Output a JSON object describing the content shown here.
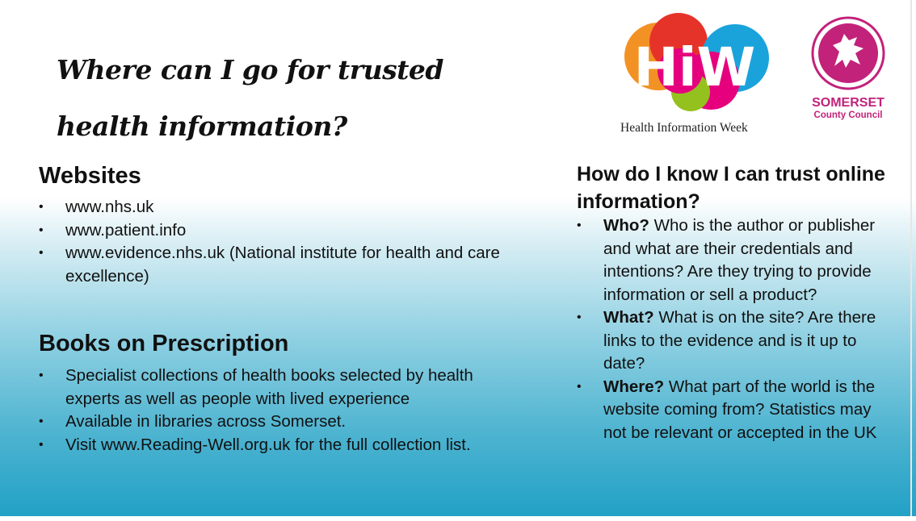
{
  "title": "Where can I go for trusted health information?",
  "logos": {
    "hiw_text": "HiW",
    "hiw_caption": "Health Information Week",
    "council_name": "SOMERSET",
    "council_sub": "County Council"
  },
  "websites": {
    "heading": "Websites",
    "items": [
      "www.nhs.uk",
      "www.patient.info",
      "www.evidence.nhs.uk (National institute for health and care excellence)"
    ]
  },
  "books": {
    "heading": "Books on Prescription",
    "items": [
      "Specialist collections of health books selected by health experts as well as people with lived experience",
      "Available in libraries across Somerset.",
      "Visit www.Reading-Well.org.uk for the full collection list."
    ]
  },
  "trust": {
    "heading": "How do I know I can trust online information?",
    "items": [
      {
        "label": "Who?",
        "text": "Who is the author or publisher and what are their credentials and intentions? Are they trying to provide information or sell a product?"
      },
      {
        "label": "What?",
        "text": "What is on the site? Are there links to the evidence and is it up to date?"
      },
      {
        "label": "Where?",
        "text": "What part of the world is the website coming from? Statistics may not be relevant or accepted in the UK"
      }
    ]
  }
}
